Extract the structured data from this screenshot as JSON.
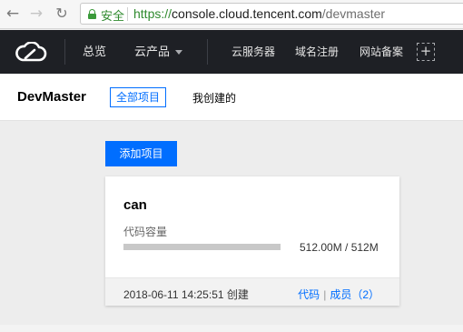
{
  "browser": {
    "secure_label": "安全",
    "url_scheme": "https://",
    "url_host": "console.cloud.tencent.com",
    "url_path": "/devmaster"
  },
  "topnav": {
    "overview": "总览",
    "products": "云产品",
    "cvm": "云服务器",
    "domain": "域名注册",
    "icp": "网站备案"
  },
  "header": {
    "title": "DevMaster",
    "tab_all": "全部项目",
    "tab_mine": "我创建的"
  },
  "actions": {
    "add_project": "添加项目"
  },
  "projects": [
    {
      "name": "can",
      "capacity_label": "代码容量",
      "capacity_value": "512.00M / 512M",
      "usage_fraction": 1.0,
      "created": "2018-06-11 14:25:51 创建",
      "link_code": "代码",
      "link_members": "成员（2）"
    }
  ],
  "colors": {
    "accent": "#006eff",
    "nav_bg": "#1e2025",
    "secure": "#2f8a2e"
  },
  "icons": {
    "back": "arrow-left-icon",
    "forward": "arrow-right-icon",
    "reload": "reload-icon",
    "lock": "lock-icon",
    "logo": "cloud-logo-icon",
    "dropdown": "caret-down-icon",
    "add": "plus-icon"
  }
}
